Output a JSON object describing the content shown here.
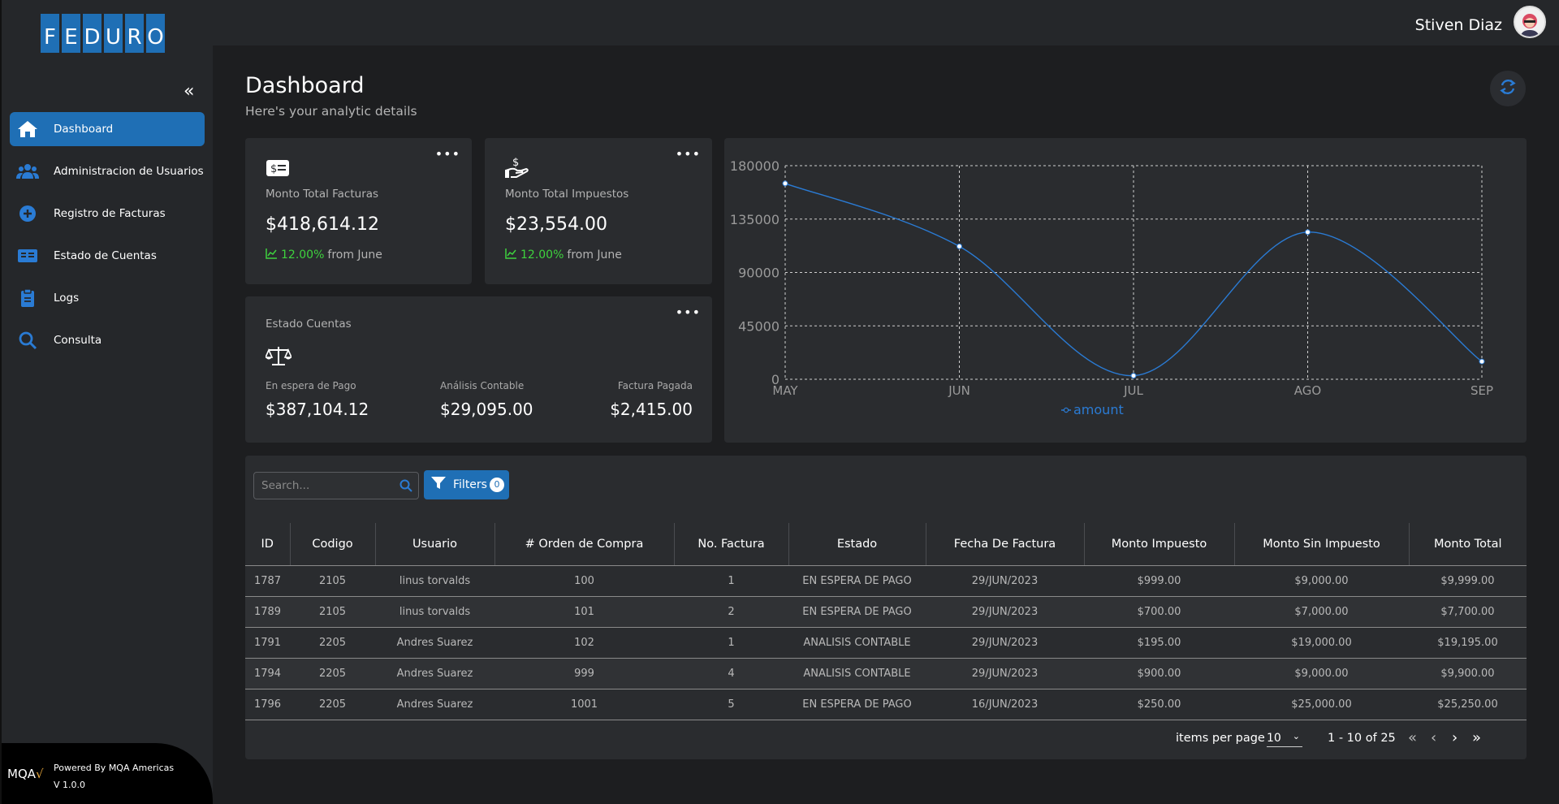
{
  "brand": {
    "logo_letters": [
      "F",
      "E",
      "D",
      "U",
      "R",
      "O"
    ]
  },
  "sidebar": {
    "items": [
      {
        "label": "Dashboard",
        "icon": "home-icon",
        "active": true
      },
      {
        "label": "Administracion de Usuarios",
        "icon": "users-icon",
        "active": false
      },
      {
        "label": "Registro de Facturas",
        "icon": "plus-circle-icon",
        "active": false
      },
      {
        "label": "Estado de Cuentas",
        "icon": "id-card-icon",
        "active": false
      },
      {
        "label": "Logs",
        "icon": "clipboard-icon",
        "active": false
      },
      {
        "label": "Consulta",
        "icon": "search-icon",
        "active": false
      }
    ],
    "footer": {
      "logo_text": "MQA",
      "logo_accent": "√",
      "powered": "Powered By MQA Americas",
      "version": "V 1.0.0"
    }
  },
  "header": {
    "user_name": "Stiven Diaz"
  },
  "page": {
    "title": "Dashboard",
    "subtitle": "Here's your analytic details"
  },
  "cards": {
    "facturas": {
      "label": "Monto Total Facturas",
      "value": "$418,614.12",
      "trend_pct": "12.00%",
      "trend_text": "from June"
    },
    "impuestos": {
      "label": "Monto Total Impuestos",
      "value": "$23,554.00",
      "trend_pct": "12.00%",
      "trend_text": "from June"
    },
    "estado": {
      "label": "Estado Cuentas",
      "items": [
        {
          "label": "En espera de Pago",
          "value": "$387,104.12"
        },
        {
          "label": "Análisis Contable",
          "value": "$29,095.00"
        },
        {
          "label": "Factura Pagada",
          "value": "$2,415.00"
        }
      ]
    }
  },
  "chart_data": {
    "type": "line",
    "categories": [
      "MAY",
      "JUN",
      "JUL",
      "AGO",
      "SEP"
    ],
    "series": [
      {
        "name": "amount",
        "values": [
          165000,
          112000,
          3000,
          124000,
          15000
        ]
      }
    ],
    "y_ticks": [
      "0",
      "45000",
      "90000",
      "135000",
      "180000"
    ],
    "ylim": [
      0,
      180000
    ],
    "grid": true,
    "legend": "bottom",
    "color": "#2a7bd4"
  },
  "table": {
    "search_placeholder": "Search...",
    "filters_label": "Filters",
    "filters_count": "0",
    "columns": [
      "ID",
      "Codigo",
      "Usuario",
      "# Orden de Compra",
      "No. Factura",
      "Estado",
      "Fecha De Factura",
      "Monto Impuesto",
      "Monto Sin Impuesto",
      "Monto Total"
    ],
    "rows": [
      [
        "1787",
        "2105",
        "linus torvalds",
        "100",
        "1",
        "EN ESPERA DE PAGO",
        "29/JUN/2023",
        "$999.00",
        "$9,000.00",
        "$9,999.00"
      ],
      [
        "1789",
        "2105",
        "linus torvalds",
        "101",
        "2",
        "EN ESPERA DE PAGO",
        "29/JUN/2023",
        "$700.00",
        "$7,000.00",
        "$7,700.00"
      ],
      [
        "1791",
        "2205",
        "Andres Suarez",
        "102",
        "1",
        "ANALISIS CONTABLE",
        "29/JUN/2023",
        "$195.00",
        "$19,000.00",
        "$19,195.00"
      ],
      [
        "1794",
        "2205",
        "Andres Suarez",
        "999",
        "4",
        "ANALISIS CONTABLE",
        "29/JUN/2023",
        "$900.00",
        "$9,000.00",
        "$9,900.00"
      ],
      [
        "1796",
        "2205",
        "Andres Suarez",
        "1001",
        "5",
        "EN ESPERA DE PAGO",
        "16/JUN/2023",
        "$250.00",
        "$25,000.00",
        "$25,250.00"
      ]
    ],
    "pagination": {
      "items_per_page_label": "items per page",
      "page_size": "10",
      "range": "1 - 10 of 25"
    }
  },
  "colors": {
    "accent": "#1f6fb5",
    "positive": "#3ed23e",
    "background": "#1d1e20",
    "card": "#2a2c2f"
  }
}
